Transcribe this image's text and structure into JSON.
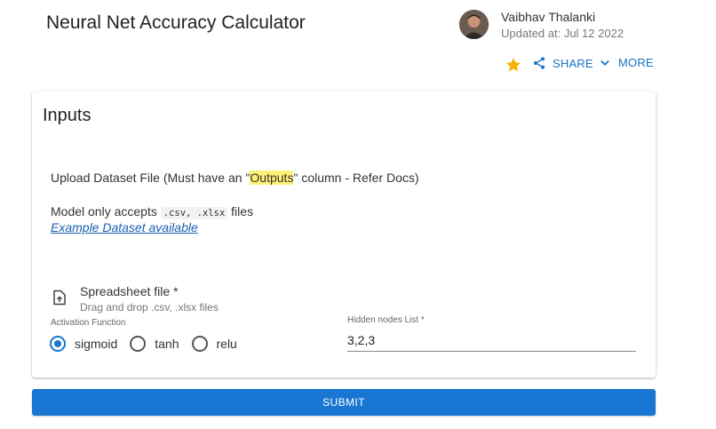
{
  "header": {
    "title": "Neural Net Accuracy Calculator",
    "author": "Vaibhav Thalanki",
    "updated": "Updated at: Jul 12 2022"
  },
  "actions": {
    "star_icon": "star-icon",
    "share_label": "SHARE",
    "more_label": "MORE",
    "star_color": "#f4b400",
    "accent": "#1a73c8"
  },
  "card": {
    "title": "Inputs",
    "upload_prefix": "Upload Dataset File (Must have an \"",
    "upload_highlight": "Outputs",
    "upload_suffix": "\" column - Refer Docs)",
    "accept_prefix": "Model only accepts ",
    "accept_code": ".csv, .xlsx",
    "accept_suffix": " files",
    "example_link": "Example Dataset available",
    "file_label": "Spreadsheet file *",
    "file_hint": "Drag and drop .csv, .xlsx files",
    "activation_label": "Activation Function",
    "activation_options": [
      "sigmoid",
      "tanh",
      "relu"
    ],
    "activation_selected": "sigmoid",
    "hidden_label": "Hidden nodes List *",
    "hidden_value": "3,2,3"
  },
  "submit_label": "SUBMIT"
}
